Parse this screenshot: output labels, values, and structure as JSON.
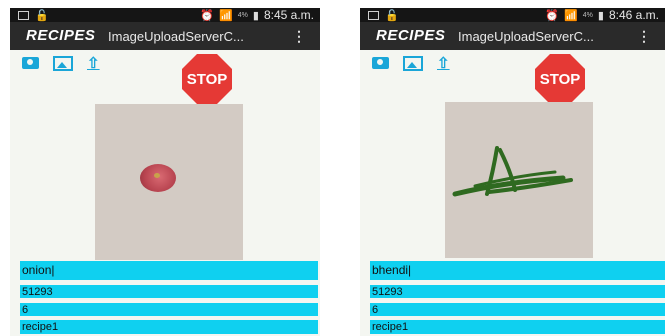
{
  "screens": [
    {
      "status": {
        "battery": "4%",
        "time": "8:45 a.m."
      },
      "app": {
        "brand": "RECIPES",
        "title": "ImageUploadServerC...",
        "menu": "⋮"
      },
      "stop_label": "STOP",
      "photo_subject": "onion",
      "fields": {
        "name": "onion",
        "number": "51293",
        "count": "6",
        "recipe": "recipe1"
      }
    },
    {
      "status": {
        "battery": "4%",
        "time": "8:46 a.m."
      },
      "app": {
        "brand": "RECIPES",
        "title": "ImageUploadServerC...",
        "menu": "⋮"
      },
      "stop_label": "STOP",
      "photo_subject": "okra",
      "fields": {
        "name": "bhendi",
        "number": "51293",
        "count": "6",
        "recipe": "recipe1"
      }
    }
  ],
  "icons": [
    "camera-icon",
    "gallery-icon",
    "upload-icon",
    "stop-sign-icon",
    "menu-overflow-icon"
  ],
  "colors": {
    "field_bg": "#0fd0f0",
    "accent": "#1aa6d8",
    "stop": "#e53935",
    "appbar": "#2a2a2a"
  }
}
